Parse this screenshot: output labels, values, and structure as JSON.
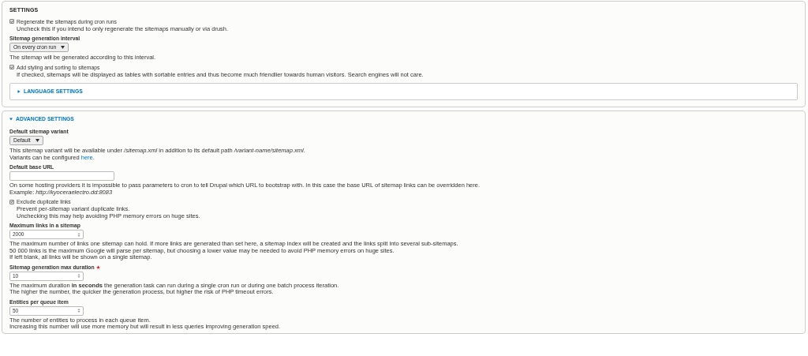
{
  "settings": {
    "title": "SETTINGS",
    "items": [
      {
        "kind": "checkbox",
        "label": "Regenerate the sitemaps during cron runs",
        "checked": true,
        "description": [
          "Uncheck this if you intend to only regenerate the sitemaps manually or via drush."
        ]
      },
      {
        "kind": "select",
        "label": "Sitemap generation interval",
        "value": "On every cron run",
        "description": [
          "The sitemap will be generated according to this interval."
        ]
      },
      {
        "kind": "checkbox",
        "label": "Add styling and sorting to sitemaps",
        "checked": true,
        "description": [
          "If checked, sitemaps will be displayed as tables with sortable entries and thus become much friendlier towards human visitors. Search engines will not care."
        ]
      },
      {
        "kind": "details",
        "label": "LANGUAGE SETTINGS",
        "expanded": false
      }
    ]
  },
  "advanced": {
    "title": "ADVANCED SETTINGS",
    "expanded": true,
    "items": [
      {
        "kind": "select",
        "label": "Default sitemap variant",
        "value": "Default",
        "description": [
          {
            "text": "This sitemap variant will be available under */sitemap.xml* in addition to its default path */variant-name/sitemap.xml*."
          },
          {
            "text": "Variants can be configured ",
            "link": "here",
            "after": "."
          }
        ]
      },
      {
        "kind": "text",
        "label": "Default base URL",
        "description": [
          {
            "text": "On some hosting providers it is impossible to pass parameters to cron to tell Drupal which URL to bootstrap with. In this case the base URL of sitemap links can be overridden here."
          },
          {
            "text": "Example: *http://kyoceraelectro.dd:8083*"
          }
        ]
      },
      {
        "kind": "checkbox",
        "label": "Exclude duplicate links",
        "checked": true,
        "description": [
          "Prevent per-sitemap variant duplicate links.",
          "Unchecking this may help avoiding PHP memory errors on huge sites."
        ]
      },
      {
        "kind": "number",
        "label": "Maximum links in a sitemap",
        "value": "2000",
        "description": [
          "The maximum number of links one sitemap can hold. If more links are generated than set here, a sitemap index will be created and the links split into several sub-sitemaps.",
          "50 000 links is the maximum Google will parse per sitemap, but choosing a lower value may be needed to avoid PHP memory errors on huge sites.",
          "If left blank, all links will be shown on a single sitemap."
        ]
      },
      {
        "kind": "number",
        "label": "Sitemap generation max duration",
        "value": "10",
        "required": true,
        "description": [
          "The maximum duration **in seconds** the generation task can run during a single cron run or during one batch process iteration.",
          "The higher the number, the quicker the generation process, but higher the risk of PHP timeout errors."
        ]
      },
      {
        "kind": "number",
        "label": "Entities per queue item",
        "value": "50",
        "description": [
          "The number of entities to process in each queue item.",
          "Increasing this number will use more memory but will result in less queries improving generation speed."
        ]
      }
    ]
  }
}
